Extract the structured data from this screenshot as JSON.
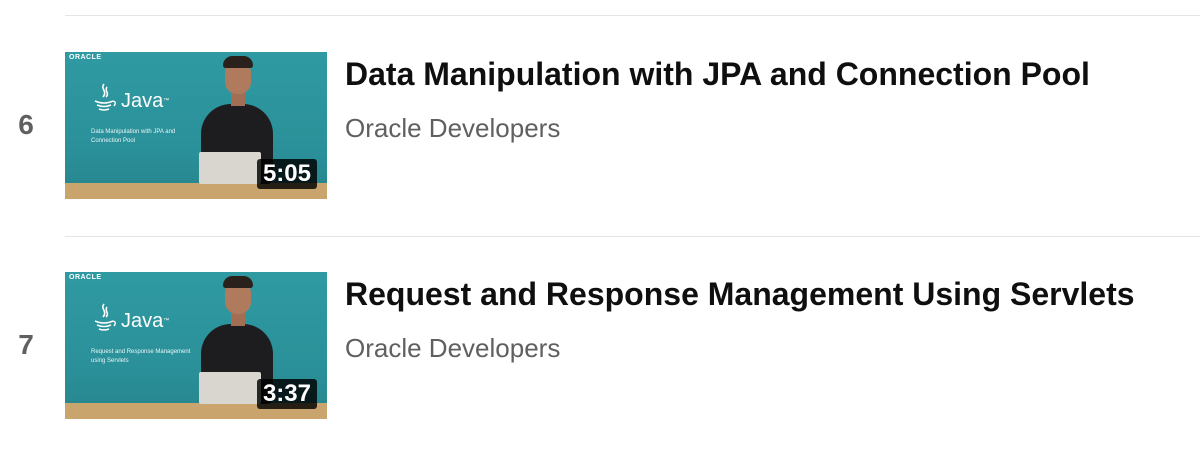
{
  "playlist": {
    "items": [
      {
        "index": "6",
        "title": "Data Manipulation with JPA and Connection Pool",
        "channel": "Oracle Developers",
        "duration": "5:05",
        "thumbnail": {
          "brand": "ORACLE",
          "product": "Java",
          "tm": "™",
          "subtitle": "Data Manipulation with JPA and Connection Pool"
        }
      },
      {
        "index": "7",
        "title": "Request and Response Management Using Servlets",
        "channel": "Oracle Developers",
        "duration": "3:37",
        "thumbnail": {
          "brand": "ORACLE",
          "product": "Java",
          "tm": "™",
          "subtitle": "Request and Response Management using Servlets"
        }
      }
    ]
  },
  "colors": {
    "thumbnail_bg": "#2a8f98",
    "title_text": "#0f0f0f",
    "secondary_text": "#606060",
    "divider": "#e5e5e5"
  }
}
